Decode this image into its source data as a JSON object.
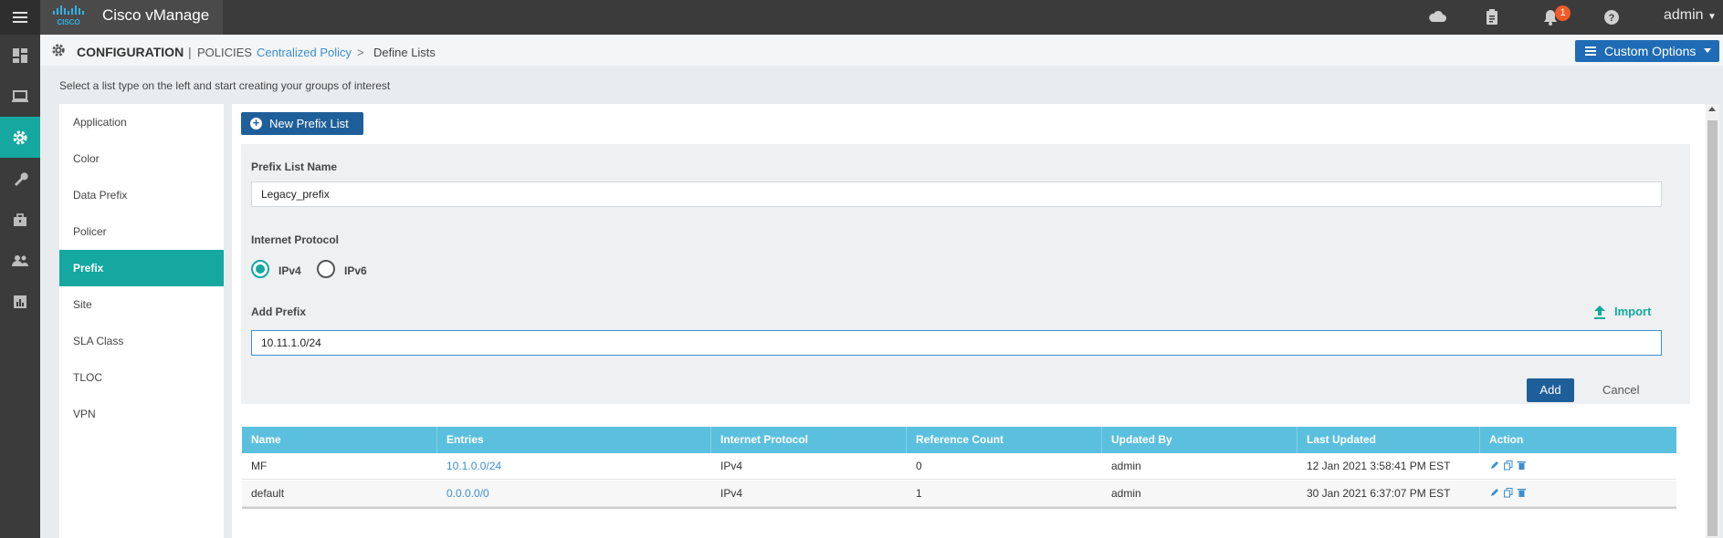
{
  "app": {
    "title": "Cisco vManage",
    "logo_text": "CISCO",
    "user": "admin",
    "notification_count": "1"
  },
  "header": {
    "title": "CONFIGURATION",
    "separator": "|",
    "subtitle": "POLICIES",
    "breadcrumb": [
      "Centralized Policy",
      ">",
      "Define Lists"
    ],
    "custom_options": "Custom Options"
  },
  "instruction": "Select a list type on the left and start creating your groups of interest",
  "list_types": [
    "Application",
    "Color",
    "Data Prefix",
    "Policer",
    "Prefix",
    "Site",
    "SLA Class",
    "TLOC",
    "VPN"
  ],
  "selected_list_type": "Prefix",
  "form": {
    "new_button": "New Prefix List",
    "name_label": "Prefix List Name",
    "name_value": "Legacy_prefix",
    "protocol_label": "Internet Protocol",
    "protocol_options": [
      "IPv4",
      "IPv6"
    ],
    "protocol_selected": "IPv4",
    "add_prefix_label": "Add Prefix",
    "add_prefix_value": "10.11.1.0/24",
    "import_label": "Import",
    "add_button": "Add",
    "cancel_button": "Cancel"
  },
  "table": {
    "columns": [
      "Name",
      "Entries",
      "Internet Protocol",
      "Reference Count",
      "Updated By",
      "Last Updated",
      "Action"
    ],
    "rows": [
      [
        "MF",
        "10.1.0.0/24",
        "IPv4",
        "0",
        "admin",
        "12 Jan 2021 3:58:41 PM EST"
      ],
      [
        "default",
        "0.0.0.0/0",
        "IPv4",
        "1",
        "admin",
        "30 Jan 2021 6:37:07 PM EST"
      ]
    ]
  },
  "colors": {
    "accent": "#14a8a0",
    "primary": "#1f5f99",
    "table_header": "#5bc0de",
    "link": "#3b8fd1"
  },
  "icons": [
    "menu-icon",
    "cisco-logo",
    "cloud-icon",
    "clipboard-icon",
    "bell-icon",
    "help-icon",
    "dashboard-icon",
    "monitor-icon",
    "gear-icon",
    "wrench-icon",
    "toolbox-icon",
    "users-icon",
    "analytics-icon",
    "plus-circle-icon",
    "upload-icon",
    "edit-icon",
    "copy-icon",
    "delete-icon"
  ]
}
